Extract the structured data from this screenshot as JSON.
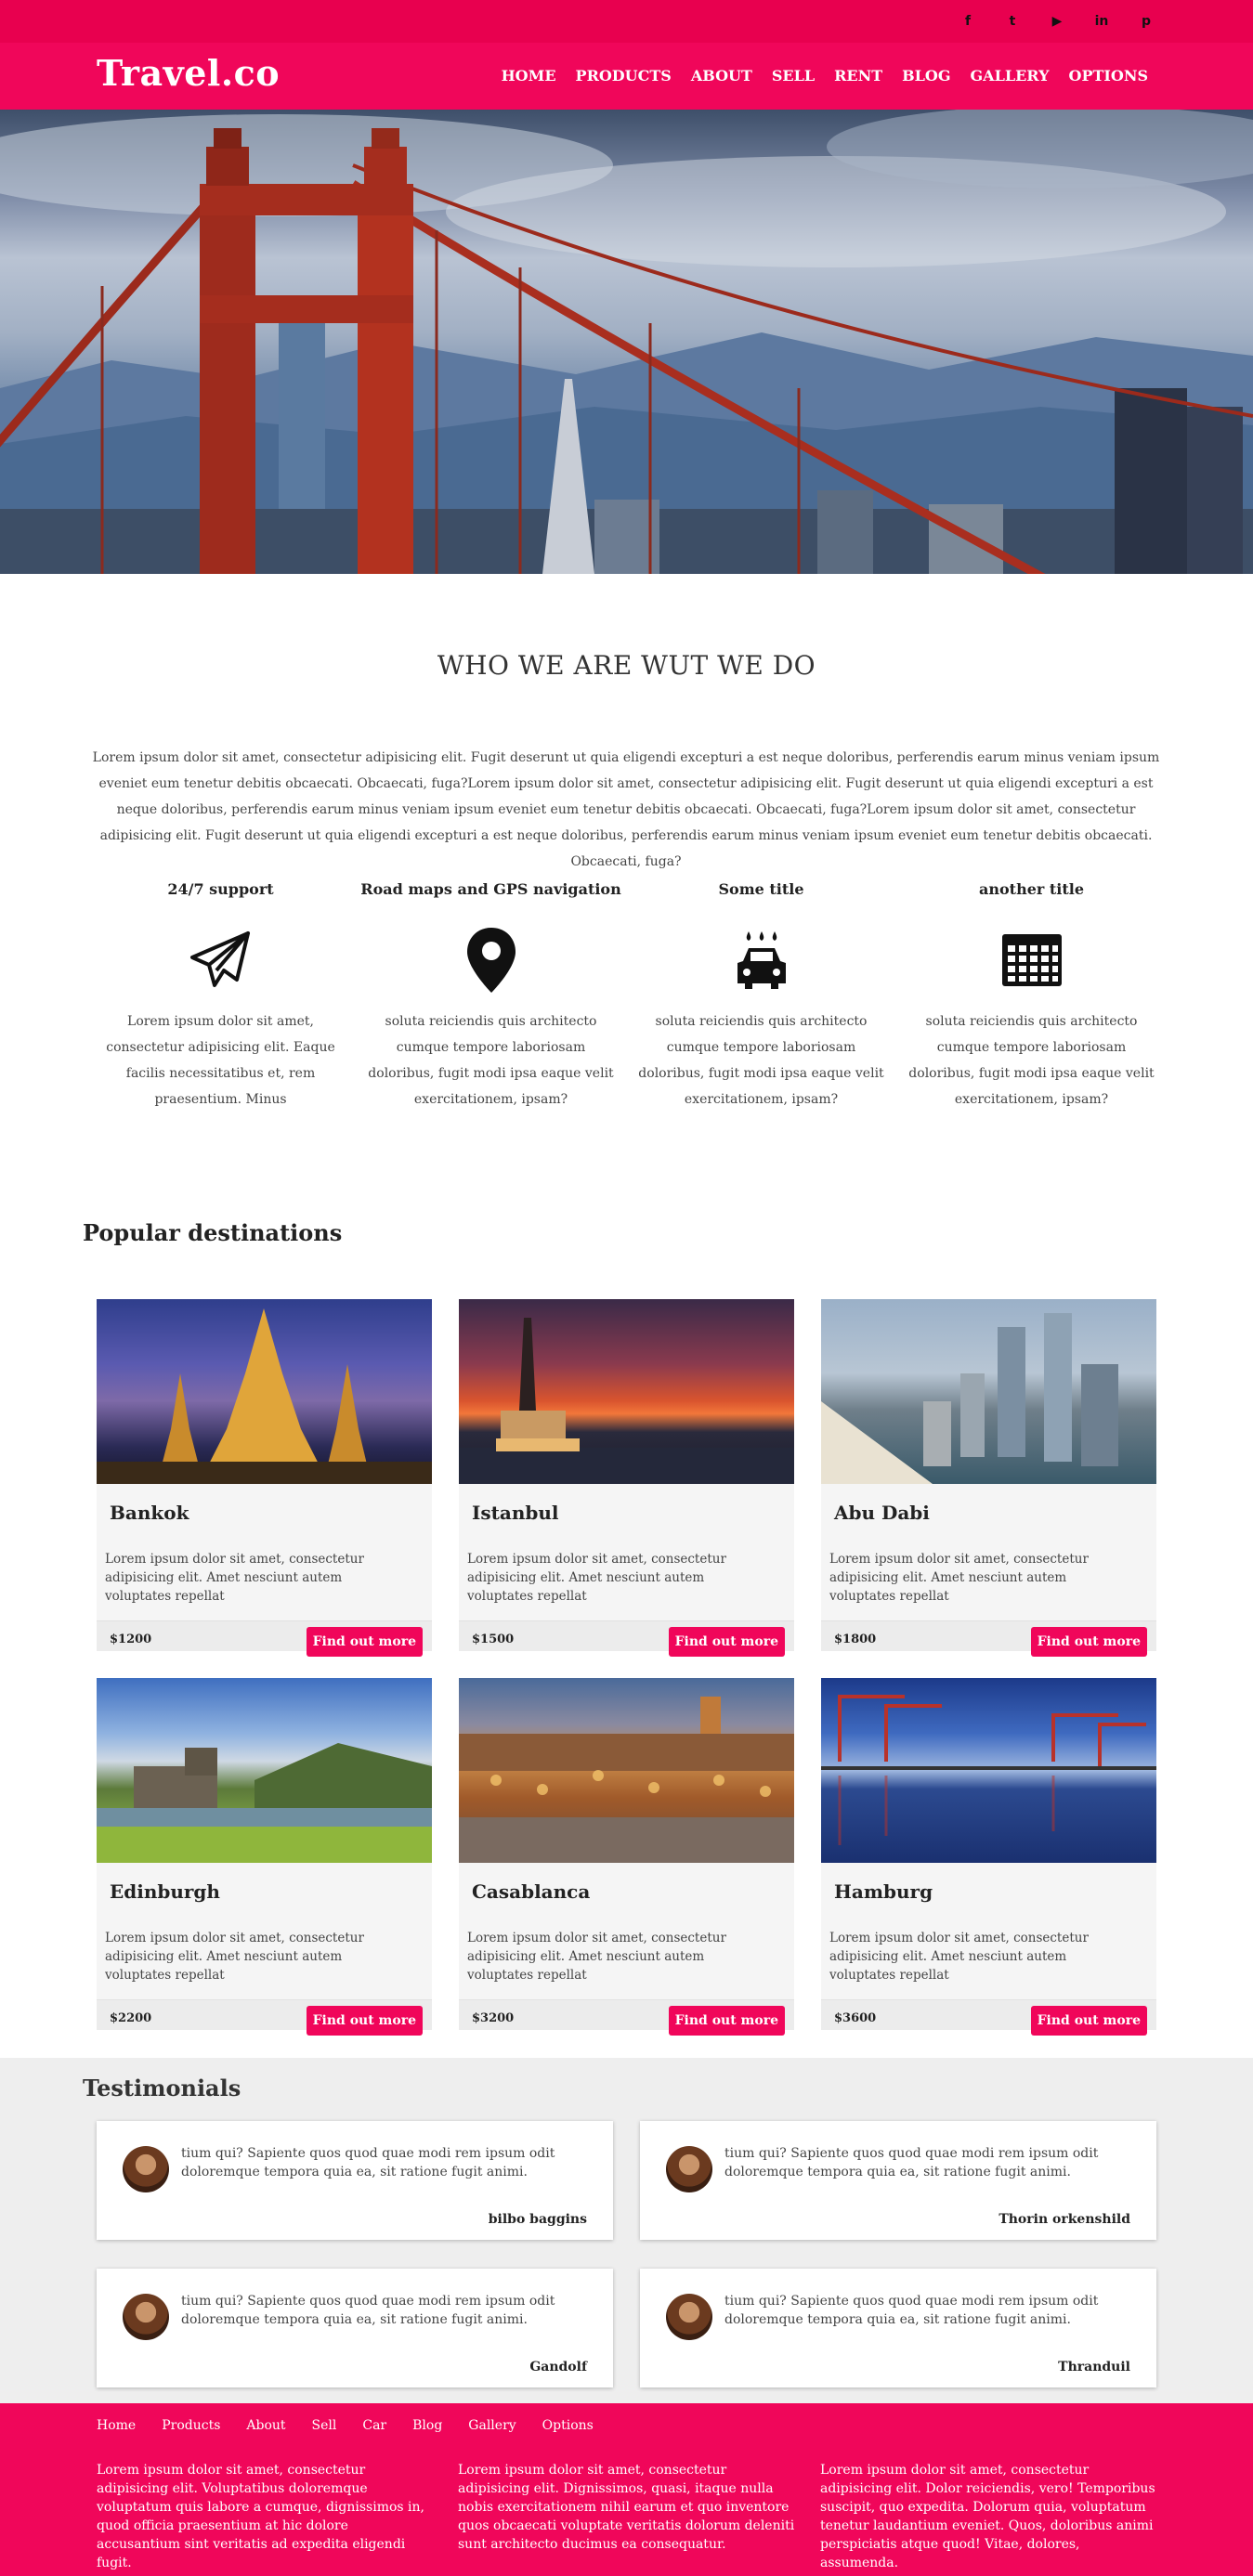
{
  "brand": {
    "logo": "Travel.co",
    "accent": "#f0065a"
  },
  "social": [
    {
      "icon": "facebook-icon",
      "glyph": "f"
    },
    {
      "icon": "twitter-icon",
      "glyph": "t"
    },
    {
      "icon": "youtube-icon",
      "glyph": "▶"
    },
    {
      "icon": "linkedin-icon",
      "glyph": "in"
    },
    {
      "icon": "pinterest-icon",
      "glyph": "p"
    }
  ],
  "nav": [
    "HOME",
    "PRODUCTS",
    "ABOUT",
    "SELL",
    "RENT",
    "BLOG",
    "GALLERY",
    "OPTIONS"
  ],
  "who": {
    "title": "WHO WE ARE WUT WE DO",
    "text": "Lorem ipsum dolor sit amet, consectetur adipisicing elit. Fugit deserunt ut quia eligendi excepturi a est neque doloribus, perferendis earum minus veniam ipsum eveniet eum tenetur debitis obcaecati. Obcaecati, fuga?Lorem ipsum dolor sit amet, consectetur adipisicing elit. Fugit deserunt ut quia eligendi excepturi a est neque doloribus, perferendis earum minus veniam ipsum eveniet eum tenetur debitis obcaecati. Obcaecati, fuga?Lorem ipsum dolor sit amet, consectetur adipisicing elit. Fugit deserunt ut quia eligendi excepturi a est neque doloribus, perferendis earum minus veniam ipsum eveniet eum tenetur debitis obcaecati. Obcaecati, fuga?"
  },
  "features": [
    {
      "title": "24/7 support",
      "icon": "paper-plane-icon",
      "text": "Lorem ipsum dolor sit amet, consectetur adipisicing elit. Eaque facilis necessitatibus et, rem praesentium. Minus"
    },
    {
      "title": "Road maps and GPS navigation",
      "icon": "map-pin-icon",
      "text": "soluta reiciendis quis architecto cumque tempore laboriosam doloribus, fugit modi ipsa eaque velit exercitationem, ipsam?"
    },
    {
      "title": "Some title",
      "icon": "car-wash-icon",
      "text": "soluta reiciendis quis architecto cumque tempore laboriosam doloribus, fugit modi ipsa eaque velit exercitationem, ipsam?"
    },
    {
      "title": "another title",
      "icon": "calendar-icon",
      "text": "soluta reiciendis quis architecto cumque tempore laboriosam doloribus, fugit modi ipsa eaque velit exercitationem, ipsam?"
    }
  ],
  "destinations": {
    "title": "Popular destinations",
    "button_label": "Find out more",
    "items": [
      {
        "name": "Bankok",
        "text": "Lorem ipsum dolor sit amet, consectetur adipisicing elit. Amet nesciunt autem voluptates repellat",
        "price": "$1200",
        "scene": "temple"
      },
      {
        "name": "Istanbul",
        "text": "Lorem ipsum dolor sit amet, consectetur adipisicing elit. Amet nesciunt autem voluptates repellat",
        "price": "$1500",
        "scene": "tower"
      },
      {
        "name": "Abu Dabi",
        "text": "Lorem ipsum dolor sit amet, consectetur adipisicing elit. Amet nesciunt autem voluptates repellat",
        "price": "$1800",
        "scene": "city"
      },
      {
        "name": "Edinburgh",
        "text": "Lorem ipsum dolor sit amet, consectetur adipisicing elit. Amet nesciunt autem voluptates repellat",
        "price": "$2200",
        "scene": "castle"
      },
      {
        "name": "Casablanca",
        "text": "Lorem ipsum dolor sit amet, consectetur adipisicing elit. Amet nesciunt autem voluptates repellat",
        "price": "$3200",
        "scene": "market"
      },
      {
        "name": "Hamburg",
        "text": "Lorem ipsum dolor sit amet, consectetur adipisicing elit. Amet nesciunt autem voluptates repellat",
        "price": "$3600",
        "scene": "harbor"
      }
    ]
  },
  "testimonials": {
    "title": "Testimonials",
    "items": [
      {
        "quote": "tium qui? Sapiente quos quod quae modi rem ipsum odit doloremque tempora quia ea, sit ratione fugit animi.",
        "author": "bilbo baggins"
      },
      {
        "quote": "tium qui? Sapiente quos quod quae modi rem ipsum odit doloremque tempora quia ea, sit ratione fugit animi.",
        "author": "Thorin orkenshild"
      },
      {
        "quote": "tium qui? Sapiente quos quod quae modi rem ipsum odit doloremque tempora quia ea, sit ratione fugit animi.",
        "author": "Gandolf"
      },
      {
        "quote": "tium qui? Sapiente quos quod quae modi rem ipsum odit doloremque tempora quia ea, sit ratione fugit animi.",
        "author": "Thranduil"
      }
    ]
  },
  "footer": {
    "nav": [
      "Home",
      "Products",
      "About",
      "Sell",
      "Car",
      "Blog",
      "Gallery",
      "Options"
    ],
    "columns": [
      "Lorem ipsum dolor sit amet, consectetur adipisicing elit. Voluptatibus doloremque voluptatum quis labore a cumque, dignissimos in, quod officia praesentium at hic dolore accusantium sint veritatis ad expedita eligendi fugit.",
      "Lorem ipsum dolor sit amet, consectetur adipisicing elit. Dignissimos, quasi, itaque nulla nobis exercitationem nihil earum et quo inventore quos obcaecati voluptate veritatis dolorum deleniti sunt architecto ducimus ea consequatur.",
      "Lorem ipsum dolor sit amet, consectetur adipisicing elit. Dolor reiciendis, vero! Temporibus suscipit, quo expedita. Dolorum quia, voluptatum tenetur laudantium eveniet. Quos, doloribus animi perspiciatis atque quod! Vitae, dolores, assumenda."
    ]
  }
}
